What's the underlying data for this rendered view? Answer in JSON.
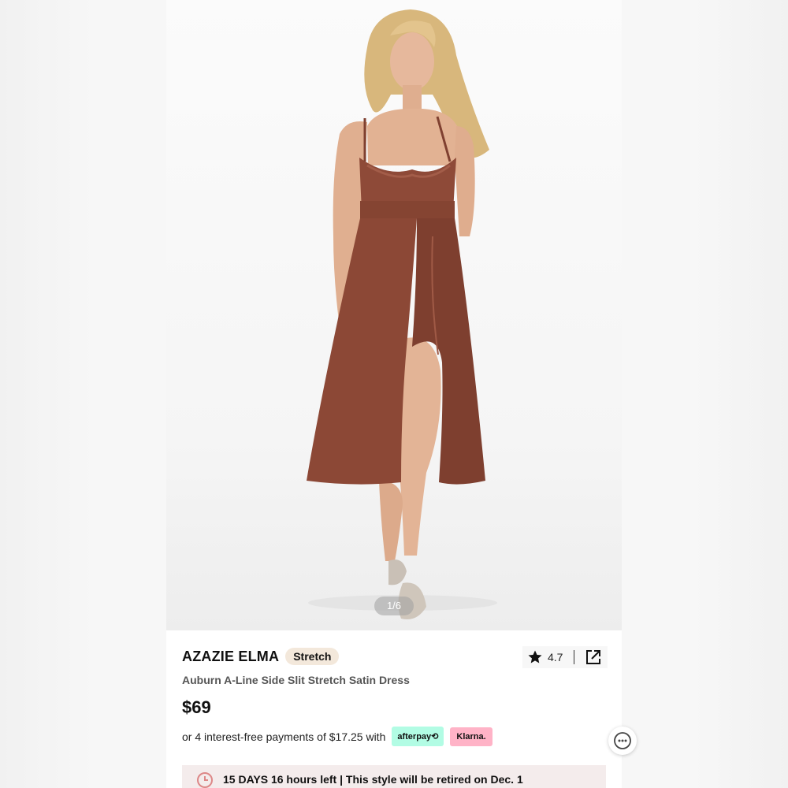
{
  "gallery": {
    "image_icon": "product-photo-auburn-satin-dress",
    "counter": "1/6"
  },
  "product": {
    "brand": "AZAZIE ELMA",
    "tag": "Stretch",
    "rating": "4.7",
    "star_icon": "star-icon",
    "share_icon": "share-icon",
    "title": "Auburn A-Line Side Slit Stretch Satin Dress",
    "price": "$69",
    "installment_text": "or 4 interest-free payments of $17.25 with",
    "afterpay_label": "afterpay⟲",
    "klarna_label": "Klarna."
  },
  "banner": {
    "clock_icon": "clock-icon",
    "text": "15 DAYS 16 hours left | This style will be retired on Dec. 1"
  },
  "floating": {
    "more_icon": "more-dots-icon"
  },
  "colors": {
    "dress": "#8e4a38",
    "tag_bg": "#f3e8db",
    "afterpay_bg": "#b2fce4",
    "klarna_bg": "#ffb3c7",
    "banner_bg": "#f4ecec"
  }
}
